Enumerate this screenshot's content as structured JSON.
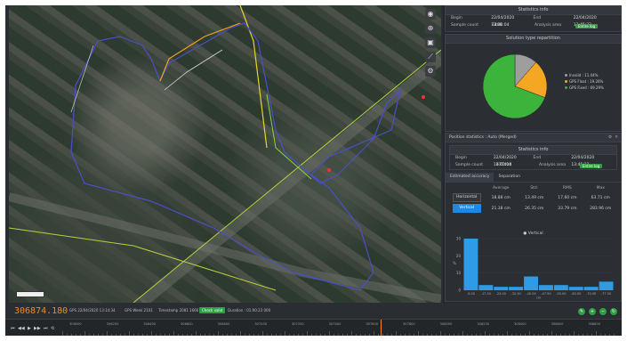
{
  "statistics_top": {
    "title": "Statistics info",
    "begin_label": "Begin",
    "begin_value": "22/04/2020 13:40:04",
    "end_label": "End",
    "end_value": "22/04/2020 13:45:32",
    "sample_label": "Sample count",
    "sample_value": "2406",
    "analysis_label": "Analysis area",
    "analysis_button": "Entire log"
  },
  "solution_panel": {
    "title": "Solution type repartition",
    "legend": [
      {
        "label": "Invalid : 11.44%",
        "color": "#9e9e9e"
      },
      {
        "label": "GPS Float : 19.26%",
        "color": "#f5a623"
      },
      {
        "label": "GPS Fixed : 69.29%",
        "color": "#3cb43c"
      }
    ]
  },
  "chart_data": [
    {
      "type": "pie",
      "series": [
        {
          "name": "Invalid",
          "value": 11.44,
          "color": "#9e9e9e"
        },
        {
          "name": "GPS Float",
          "value": 19.26,
          "color": "#f5a623"
        },
        {
          "name": "GPS Fixed",
          "value": 69.29,
          "color": "#3cb43c"
        }
      ]
    },
    {
      "type": "bar",
      "legend": "Vertical",
      "color": "#2e9be6",
      "categories": [
        "-5.00",
        "-17.50",
        "-25.00",
        "-32.50",
        "-40.00",
        "-47.50",
        "-55.00",
        "-62.50",
        "-70.00",
        "-77.50"
      ],
      "values": [
        30,
        3,
        2,
        2,
        8,
        3,
        3,
        2,
        2,
        5
      ],
      "ylim": [
        0,
        30
      ],
      "yticks": [
        "30",
        "20",
        "10",
        "0"
      ],
      "xlabel": "cm",
      "ylabel": "%"
    }
  ],
  "position_panel": {
    "title": "Position statistics : Auto (Merged)",
    "stats_title": "Statistics info",
    "begin_label": "Begin",
    "begin_value": "22/04/2020 13:40:04",
    "end_label": "End",
    "end_value": "22/04/2020 13:45:32",
    "sample_label": "Sample count",
    "sample_value": "677410",
    "analysis_label": "Analysis area",
    "analysis_button": "Entire log",
    "tabs": [
      "Estimated accuracy",
      "Separation"
    ],
    "columns": [
      "Average",
      "Std.",
      "RMS",
      "Max"
    ],
    "rows": [
      {
        "label": "Horizontal",
        "values": [
          "18.88 cm",
          "13.49 cm",
          "17.60 cm",
          "63.71 cm"
        ]
      },
      {
        "label": "Vertical",
        "values": [
          "21.38 cm",
          "26.35 cm",
          "33.79 cm",
          "283.96 cm"
        ]
      }
    ]
  },
  "status_bar": {
    "epoch": "306874.180",
    "gps_time": "GPS 22/04/2020 13:14:34",
    "gps_week": "GPS Week 2101",
    "timestamp": "Timestamp 2081 1666",
    "badge": "Check valid",
    "duration": "Duration : 01:00:23 000"
  },
  "timeline": {
    "ticks": [
      "306000",
      "306200",
      "306400",
      "306600",
      "306800",
      "307000",
      "307200",
      "307400",
      "307600",
      "307800",
      "308000",
      "308200",
      "308400",
      "308600",
      "308800"
    ]
  }
}
